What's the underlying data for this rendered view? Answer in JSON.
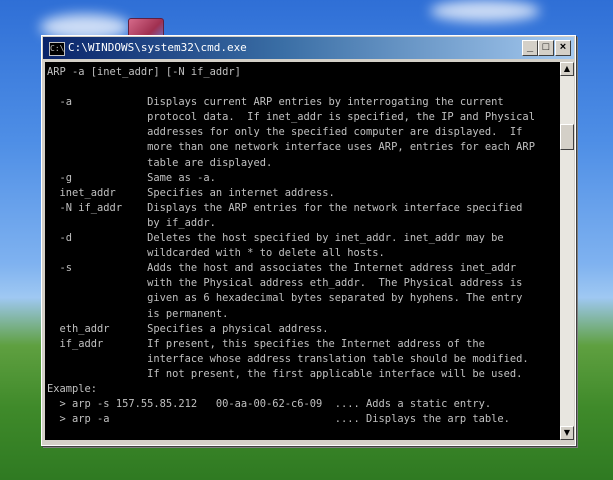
{
  "window": {
    "title": "C:\\WINDOWS\\system32\\cmd.exe",
    "icon": "cmd-icon"
  },
  "console_lines": [
    "ARP -a [inet_addr] [-N if_addr]",
    "",
    "  -a            Displays current ARP entries by interrogating the current",
    "                protocol data.  If inet_addr is specified, the IP and Physical",
    "                addresses for only the specified computer are displayed.  If",
    "                more than one network interface uses ARP, entries for each ARP",
    "                table are displayed.",
    "  -g            Same as -a.",
    "  inet_addr     Specifies an internet address.",
    "  -N if_addr    Displays the ARP entries for the network interface specified",
    "                by if_addr.",
    "  -d            Deletes the host specified by inet_addr. inet_addr may be",
    "                wildcarded with * to delete all hosts.",
    "  -s            Adds the host and associates the Internet address inet_addr",
    "                with the Physical address eth_addr.  The Physical address is",
    "                given as 6 hexadecimal bytes separated by hyphens. The entry",
    "                is permanent.",
    "  eth_addr      Specifies a physical address.",
    "  if_addr       If present, this specifies the Internet address of the",
    "                interface whose address translation table should be modified.",
    "                If not present, the first applicable interface will be used.",
    "Example:",
    "  > arp -s 157.55.85.212   00-aa-00-62-c6-09  .... Adds a static entry.",
    "  > arp -a                                    .... Displays the arp table."
  ],
  "colors": {
    "console_bg": "#000000",
    "console_fg": "#c0c0c0",
    "titlebar_start": "#0a246a",
    "titlebar_end": "#a6caf0"
  }
}
